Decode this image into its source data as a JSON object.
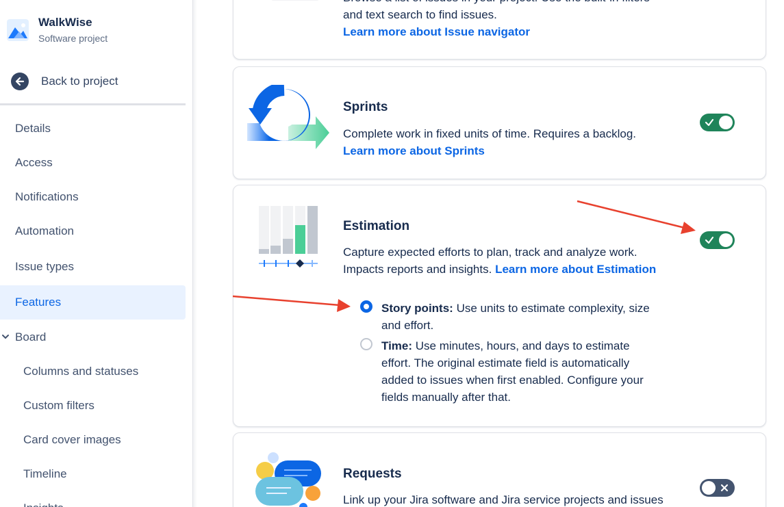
{
  "project": {
    "name": "WalkWise",
    "type": "Software project"
  },
  "sidebar": {
    "back_label": "Back to project",
    "items": [
      {
        "label": "Details"
      },
      {
        "label": "Access"
      },
      {
        "label": "Notifications"
      },
      {
        "label": "Automation"
      },
      {
        "label": "Issue types"
      },
      {
        "label": "Features",
        "active": true
      },
      {
        "label": "Board",
        "expanded": true
      },
      {
        "label": "Columns and statuses"
      },
      {
        "label": "Custom filters"
      },
      {
        "label": "Card cover images"
      },
      {
        "label": "Timeline"
      },
      {
        "label": "Insights"
      }
    ]
  },
  "features": {
    "issue_navigator": {
      "desc_line1": "Browse a list of issues in your project. Use the built-in filters",
      "desc_line2": "and text search to find issues.",
      "link": "Learn more about Issue navigator"
    },
    "sprints": {
      "title": "Sprints",
      "desc": "Complete work in fixed units of time. Requires a backlog.",
      "link": "Learn more about Sprints",
      "enabled": true
    },
    "estimation": {
      "title": "Estimation",
      "desc_line1": "Capture expected efforts to plan, track and analyze work.",
      "desc_line2": "Impacts reports and insights.",
      "link": "Learn more about Estimation",
      "enabled": true,
      "options": [
        {
          "name": "Story points:",
          "desc": " Use units to estimate complexity, size and effort.",
          "selected": true
        },
        {
          "name": "Time:",
          "desc": " Use minutes, hours, and days to estimate effort. The original estimate field is automatically added to issues when first enabled. Configure your fields manually after that.",
          "selected": false
        }
      ]
    },
    "requests": {
      "title": "Requests",
      "desc": "Link up your Jira software and Jira service projects and issues",
      "enabled": false
    }
  },
  "colors": {
    "accent": "#0c66e4",
    "toggle_on": "#1f845a",
    "toggle_off": "#44546f",
    "annotation_arrow": "#e8412e"
  }
}
